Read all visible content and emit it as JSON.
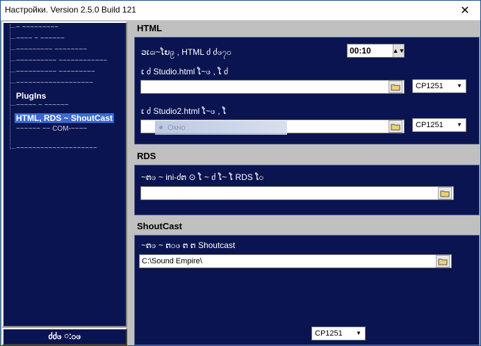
{
  "window": {
    "title": "Настройки. Version 2.5.0 Build 121",
    "close": "✕"
  },
  "tree": {
    "items": [
      {
        "label": "~ ~~~~~~~~~",
        "kind": "glyph"
      },
      {
        "label": "~~~~ ~ ~~~~~~",
        "kind": "glyph"
      },
      {
        "label": "~~~~~~~~~ ~~~~~~~~",
        "kind": "glyph"
      },
      {
        "label": "~~~~~~~~~~ ~~~~~~~~~~~~",
        "kind": "glyph"
      },
      {
        "label": "~~~~~~~~~~ ~~~~~~~~~",
        "kind": "glyph"
      },
      {
        "label": "~~~~~~~~~~~~~~~~~~~",
        "kind": "glyph"
      },
      {
        "label": "PlugIns",
        "kind": "plain"
      },
      {
        "label": "~~~~~ ~ ~~~~~~",
        "kind": "glyph"
      },
      {
        "label": "HTML, RDS ~ ShoutCast",
        "kind": "selected"
      },
      {
        "label": "~~~~~~ ~~ COM-~~~~",
        "kind": "glyph"
      },
      {
        "label": "~~~~~~~~~~~~~~~~~~~~",
        "kind": "glyph"
      }
    ],
    "bottom_button": "ძძဖ ៈ၀ဖ"
  },
  "html_section": {
    "header": "HTML",
    "interval_label": "ວເ၊ေ~ໂຍ၉ , HTML ძ ძဖ၇၀",
    "interval_value": "00:10",
    "file1_label": "ເ ძ Studio.html ໂ~ဖ , ໂ ძ",
    "file1_value": "",
    "file1_encoding": "CP1251",
    "file2_label": "ເ ძ Studio2.html ໂ~ဖ , ໂ",
    "file2_value": "",
    "file2_encoding": "CP1251",
    "ghost_text": "Окно"
  },
  "rds_section": {
    "header": "RDS",
    "label": "~ຕဖ ~ ini-ძຕ ⊙ ໂ ~ ძ ໂ~ ໂ RDS ໂ၀",
    "value": ""
  },
  "shoutcast_section": {
    "header": "ShoutCast",
    "label": "~ຕဖ ~ ຕ၀ဖ ຕ ຕ Shoutcast",
    "value": "C:\\Sound Empire\\",
    "encoding": "CP1251"
  },
  "colors": {
    "panel_bg": "#0a1450",
    "selected": "#3a6ad0",
    "client_bg": "#c0c0c0"
  }
}
